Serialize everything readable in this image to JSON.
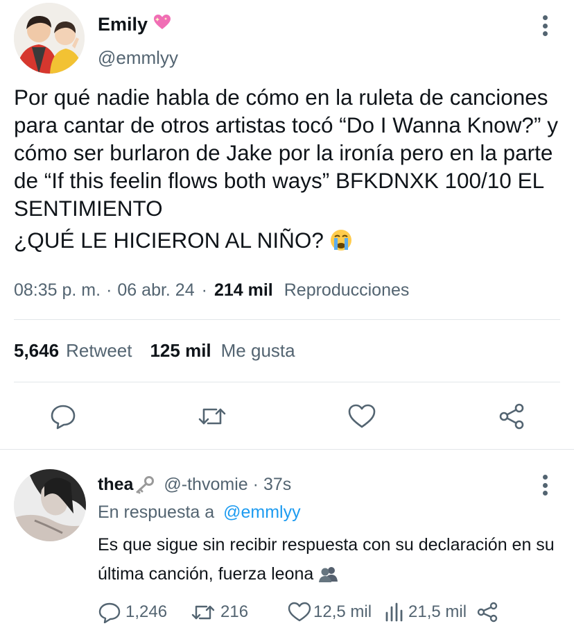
{
  "tweet": {
    "author_name": "Emily",
    "author_badge_icon": "sparkling-heart-emoji",
    "author_handle": "@emmlyy",
    "text_paragraph_1": "Por qué nadie habla de cómo en la ruleta de canciones para cantar de otros artistas tocó “Do I Wanna Know?” y cómo ser burlaron de Jake por la ironía pero en la parte de “If this feelin flows both ways” BFKDNXK 100/10 EL SENTIMIENTO",
    "text_paragraph_2": "¿QUÉ LE HICIERON AL NIÑO?",
    "text_emoji": "crying-face-emoji",
    "time": "08:35 p. m.",
    "date": "06 abr. 24",
    "separator": "·",
    "views_count": "214 mil",
    "views_label": "Reproducciones",
    "retweet_count": "5,646",
    "retweet_label": "Retweet",
    "likes_count": "125 mil",
    "likes_label": "Me gusta",
    "action_icons": [
      "reply-icon",
      "retweet-icon",
      "like-icon",
      "share-icon"
    ]
  },
  "reply": {
    "name": "thea",
    "name_emoji": "key-emoji",
    "handle": "@-thvomie",
    "separator": "·",
    "time": "37s",
    "replying_prefix": "En respuesta a",
    "replying_to": "@emmlyy",
    "text": "Es que sigue sin recibir respuesta con su declaración en su última canción, fuerza leona",
    "text_emoji": "busts-in-silhouette-emoji",
    "reply_count": "1,246",
    "retweet_count": "216",
    "like_count": "12,5 mil",
    "views_count": "21,5 mil"
  },
  "colors": {
    "text_primary": "#0f1419",
    "text_secondary": "#536471",
    "link": "#1d9bf0",
    "divider": "#e2e6e9"
  }
}
